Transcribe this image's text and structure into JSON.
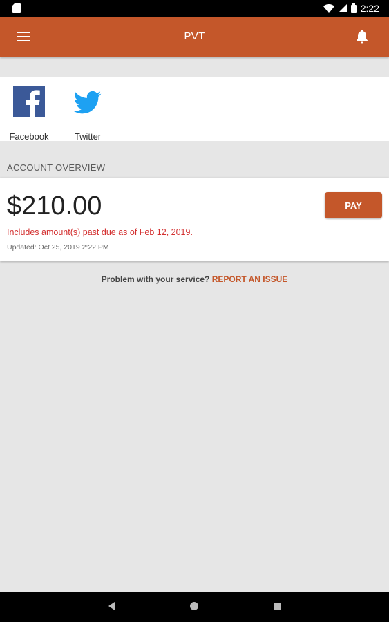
{
  "status_bar": {
    "time": "2:22"
  },
  "app_bar": {
    "title": "PVT"
  },
  "social": [
    {
      "label": "Facebook",
      "icon": "facebook-icon",
      "color": "#3b5998"
    },
    {
      "label": "Twitter",
      "icon": "twitter-icon",
      "color": "#1da1f2"
    }
  ],
  "account": {
    "section_label": "ACCOUNT OVERVIEW",
    "amount": "$210.00",
    "past_due_note": "Includes amount(s) past due as of Feb 12, 2019.",
    "updated": "Updated:  Oct 25, 2019 2:22 PM",
    "pay_label": "PAY"
  },
  "problem": {
    "question": "Problem with your service?",
    "link": "REPORT AN ISSUE"
  },
  "colors": {
    "accent": "#c4572a",
    "alert": "#d32f2f",
    "background": "#e6e6e6"
  }
}
